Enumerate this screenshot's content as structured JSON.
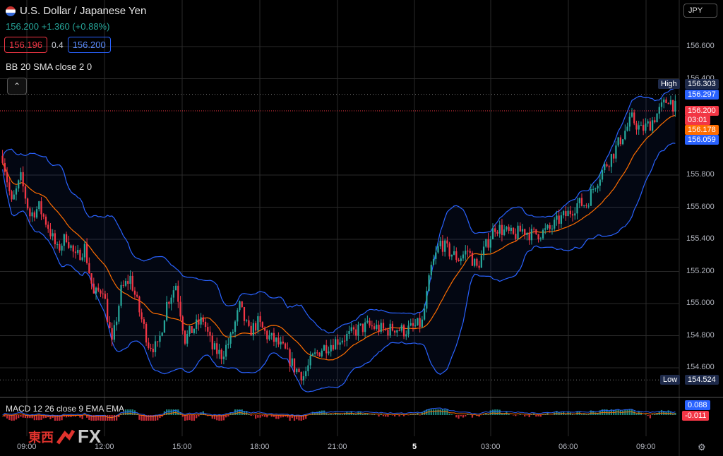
{
  "header": {
    "symbol_title": "U.S. Dollar / Japanese Yen",
    "change_text": "156.200 +1.360 (+0.88%)",
    "sell_price": "156.196",
    "spread": "0.4",
    "buy_price": "156.200",
    "currency_selector": "JPY"
  },
  "indicators": {
    "bb_label": "BB 20 SMA close 2 0",
    "macd_label": "MACD 12 26 close 9 EMA EMA"
  },
  "price_axis": {
    "ticks": [
      "156.600",
      "156.400",
      "155.800",
      "155.600",
      "155.400",
      "155.200",
      "155.000",
      "154.800",
      "154.600"
    ],
    "high_label": "High",
    "high_value": "156.303",
    "low_label": "Low",
    "low_value": "154.524",
    "upper_band": "156.297",
    "current_price": "156.200",
    "countdown": "03:01",
    "middle_band": "156.178",
    "lower_band": "156.059",
    "macd_value": "0.088",
    "macd_signal": "-0.011"
  },
  "time_axis": [
    "09:00",
    "12:00",
    "15:00",
    "18:00",
    "21:00",
    "5",
    "03:00",
    "06:00",
    "09:00"
  ],
  "branding": {
    "logo_kanji": "東西",
    "logo_fx": "FX"
  },
  "colors": {
    "up": "#26a69a",
    "down": "#f23645",
    "band": "#2962ff",
    "basis": "#ff6d00",
    "macd_line": "#2962ff",
    "signal_line": "#ff6d00"
  },
  "chart_data": {
    "type": "candlestick",
    "ylim": [
      154.45,
      156.72
    ],
    "path": [
      [
        0,
        155.92
      ],
      [
        4,
        155.62
      ],
      [
        8,
        155.78
      ],
      [
        12,
        155.55
      ],
      [
        16,
        155.6
      ],
      [
        20,
        155.48
      ],
      [
        24,
        155.33
      ],
      [
        28,
        155.42
      ],
      [
        32,
        155.28
      ],
      [
        36,
        155.35
      ],
      [
        40,
        155.05
      ],
      [
        44,
        155.1
      ],
      [
        48,
        154.74
      ],
      [
        52,
        155.08
      ],
      [
        56,
        155.16
      ],
      [
        60,
        154.95
      ],
      [
        64,
        154.75
      ],
      [
        68,
        154.72
      ],
      [
        72,
        155.0
      ],
      [
        76,
        155.12
      ],
      [
        80,
        154.78
      ],
      [
        84,
        154.85
      ],
      [
        88,
        154.9
      ],
      [
        92,
        154.72
      ],
      [
        96,
        154.68
      ],
      [
        100,
        154.78
      ],
      [
        104,
        154.98
      ],
      [
        108,
        154.82
      ],
      [
        112,
        154.88
      ],
      [
        116,
        154.8
      ],
      [
        120,
        154.76
      ],
      [
        124,
        154.7
      ],
      [
        128,
        154.6
      ],
      [
        132,
        154.55
      ],
      [
        136,
        154.66
      ],
      [
        140,
        154.72
      ],
      [
        144,
        154.75
      ],
      [
        148,
        154.78
      ],
      [
        152,
        154.8
      ],
      [
        156,
        154.84
      ],
      [
        160,
        154.86
      ],
      [
        164,
        154.85
      ],
      [
        168,
        154.83
      ],
      [
        172,
        154.85
      ],
      [
        176,
        154.83
      ],
      [
        180,
        154.85
      ],
      [
        184,
        154.88
      ],
      [
        188,
        155.22
      ],
      [
        192,
        155.38
      ],
      [
        196,
        155.32
      ],
      [
        200,
        155.28
      ],
      [
        204,
        155.33
      ],
      [
        208,
        155.22
      ],
      [
        212,
        155.36
      ],
      [
        216,
        155.48
      ],
      [
        220,
        155.45
      ],
      [
        224,
        155.42
      ],
      [
        228,
        155.46
      ],
      [
        232,
        155.43
      ],
      [
        236,
        155.44
      ],
      [
        240,
        155.46
      ],
      [
        244,
        155.52
      ],
      [
        248,
        155.56
      ],
      [
        252,
        155.62
      ],
      [
        256,
        155.62
      ],
      [
        260,
        155.75
      ],
      [
        264,
        155.85
      ],
      [
        268,
        155.94
      ],
      [
        272,
        156.05
      ],
      [
        276,
        156.15
      ],
      [
        280,
        156.08
      ],
      [
        284,
        156.12
      ],
      [
        288,
        156.2
      ],
      [
        292,
        156.28
      ],
      [
        296,
        156.2
      ]
    ],
    "n_candles": 296,
    "bands_shape": "wraps price",
    "macd": {
      "macd": 0.088,
      "signal": -0.011
    }
  }
}
